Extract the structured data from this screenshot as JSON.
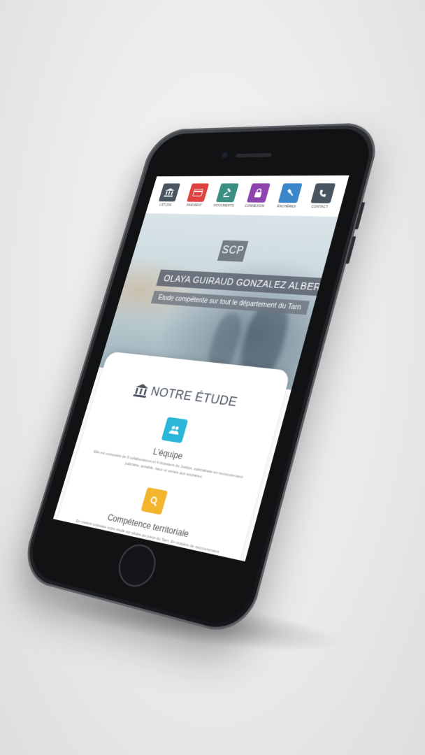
{
  "nav": {
    "items": [
      {
        "label": "L'étude",
        "icon": "bank-icon",
        "color": "#4a5562"
      },
      {
        "label": "Paiement",
        "icon": "card-icon",
        "color": "#e0423f"
      },
      {
        "label": "Documents",
        "icon": "gavel-icon",
        "color": "#3a8e82"
      },
      {
        "label": "Connexion",
        "icon": "lock-icon",
        "color": "#8e44ad"
      },
      {
        "label": "Enchères",
        "icon": "hammer-icon",
        "color": "#3a86c8"
      },
      {
        "label": "Contact",
        "icon": "phone-icon",
        "color": "#4a5562"
      }
    ]
  },
  "hero": {
    "badge": "SCP",
    "name": "Olaya Guiraud Gonzalez Alberge",
    "subtitle": "Étude compétente sur tout le département du Tarn"
  },
  "section": {
    "title": "NOTRE ÉTUDE",
    "features": [
      {
        "title": "L'équipe",
        "text": "Elle est composée de 9 collaborateurs et 4 Huissiers de Justice, spécialisée en recouvrement judiciaire, amiable, baux et ventes aux enchères.",
        "icon": "team-icon",
        "color": "#29b6d8"
      },
      {
        "title": "Compétence territoriale",
        "text": "En matière judiciaire notre étude est située au cœur du Tarn. En matière de recouvrement notre compétence territoriale s'étend au Département du Tarn. En matière de recouvrement amiable notre territorialité est sans limite.",
        "icon": "search-icon",
        "color": "#f4b52e"
      },
      {
        "title": "",
        "text": "",
        "icon": "camera-icon",
        "color": "#a0603a"
      }
    ]
  }
}
